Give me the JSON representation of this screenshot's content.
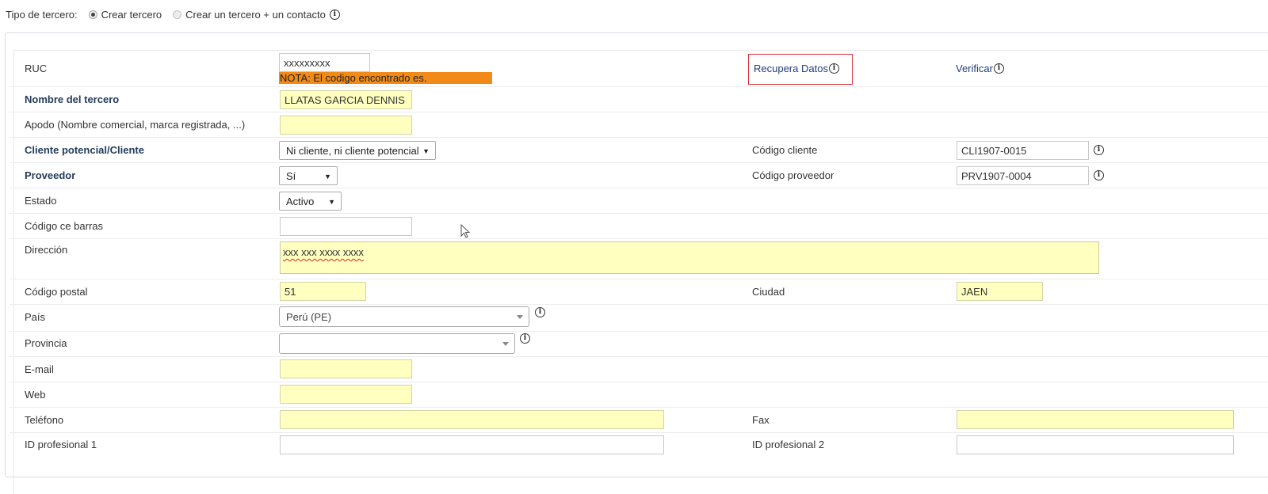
{
  "top": {
    "label": "Tipo de tercero:",
    "radio1": "Crear tercero",
    "radio2": "Crear un tercero + un contacto"
  },
  "ruc": {
    "label": "RUC",
    "value": "xxxxxxxxx",
    "note": "NOTA: El codigo encontrado es.",
    "recupera": "Recupera Datos",
    "verificar": "Verificar"
  },
  "nombre": {
    "label": "Nombre del tercero",
    "value": "LLATAS GARCIA DENNIS I"
  },
  "apodo": {
    "label": "Apodo (Nombre comercial, marca registrada, ...)",
    "value": ""
  },
  "cliente": {
    "label": "Cliente potencial/Cliente",
    "selected": "Ni cliente, ni cliente potencial",
    "code_label": "Código cliente",
    "code_value": "CLI1907-0015"
  },
  "proveedor": {
    "label": "Proveedor",
    "selected": "Sí",
    "code_label": "Código proveedor",
    "code_value": "PRV1907-0004"
  },
  "estado": {
    "label": "Estado",
    "selected": "Activo"
  },
  "barras": {
    "label": "Código ce barras",
    "value": ""
  },
  "direccion": {
    "label": "Dirección",
    "value": "xxx xxx xxxx xxxx"
  },
  "postal": {
    "label": "Código postal",
    "value": "51",
    "city_label": "Ciudad",
    "city_value": "JAEN"
  },
  "pais": {
    "label": "País",
    "selected": "Perú (PE)"
  },
  "provincia": {
    "label": "Provincia",
    "selected": ""
  },
  "email": {
    "label": "E-mail",
    "value": ""
  },
  "web": {
    "label": "Web",
    "value": ""
  },
  "telefono": {
    "label": "Teléfono",
    "value": "",
    "fax_label": "Fax",
    "fax_value": ""
  },
  "idprof": {
    "label": "ID profesional 1",
    "label2": "ID profesional 2"
  }
}
